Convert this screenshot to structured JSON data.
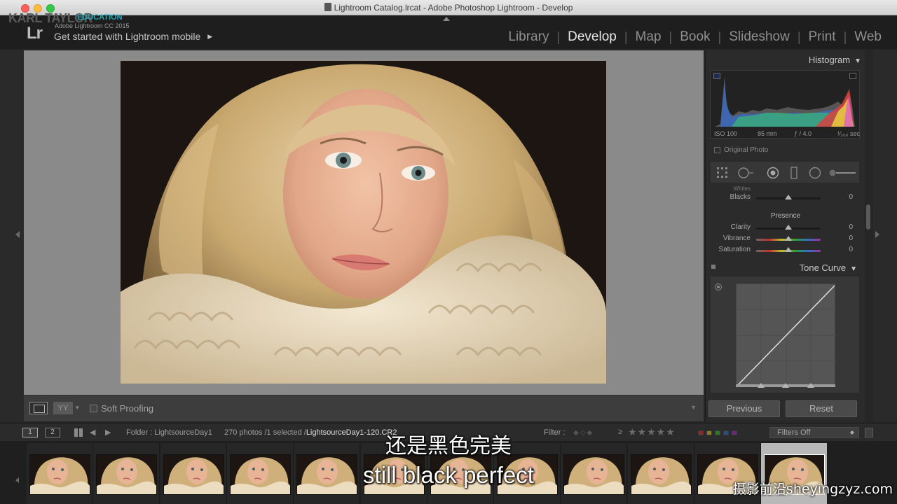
{
  "window": {
    "title": "Lightroom Catalog.lrcat - Adobe Photoshop Lightroom - Develop"
  },
  "branding": {
    "name": "KARL TAYLOR",
    "tag": "EDUCATION",
    "lr_logo": "Lr",
    "product": "Adobe Lightroom CC 2015",
    "mobile_prompt": "Get started with Lightroom mobile",
    "mobile_arrow": "▶"
  },
  "modules": {
    "items": [
      "Library",
      "Develop",
      "Map",
      "Book",
      "Slideshow",
      "Print",
      "Web"
    ],
    "separator": "|",
    "active": "Develop"
  },
  "toolbar": {
    "yy": "YY",
    "dropdown": "▾",
    "soft_proofing": "Soft Proofing"
  },
  "histogram": {
    "title": "Histogram",
    "collapse": "▼",
    "iso": "ISO 100",
    "focal": "85 mm",
    "aperture": "ƒ / 4.0",
    "shutter": "¹⁄₂₀₀ sec",
    "original_photo": "Original Photo"
  },
  "basic": {
    "whites_label": "Whites",
    "blacks": {
      "label": "Blacks",
      "value": "0",
      "position": 0.5
    },
    "presence_title": "Presence",
    "presence": [
      {
        "label": "Clarity",
        "value": "0",
        "position": 0.5
      },
      {
        "label": "Vibrance",
        "value": "0",
        "position": 0.5
      },
      {
        "label": "Saturation",
        "value": "0",
        "position": 0.5
      }
    ]
  },
  "tone_curve": {
    "title": "Tone Curve",
    "collapse": "▼"
  },
  "buttons": {
    "previous": "Previous",
    "reset": "Reset"
  },
  "filmstrip": {
    "screen1": "1",
    "screen2": "2",
    "back_arrow": "◀",
    "forward_arrow": "▶",
    "folder": "Folder : LightsourceDay1",
    "count": "270 photos /1 selected /",
    "current_file": "LightsourceDay1-120.CR2",
    "filter_label": "Filter :",
    "flags": "◆◇◆",
    "gte": "≥",
    "stars": "★★★★★",
    "swatch_colors": [
      "#8a2a2a",
      "#8a7a2a",
      "#2a7a2a",
      "#2a4a8a",
      "#6a2a7a"
    ],
    "filters_off": "Filters Off",
    "filters_dd": "◆",
    "thumbnail_count": 12,
    "selected_index": 11
  },
  "subtitles": {
    "chinese": "还是黑色完美",
    "english": "still black perfect"
  },
  "watermark": "摄影前沿sheyingzyz.com"
}
